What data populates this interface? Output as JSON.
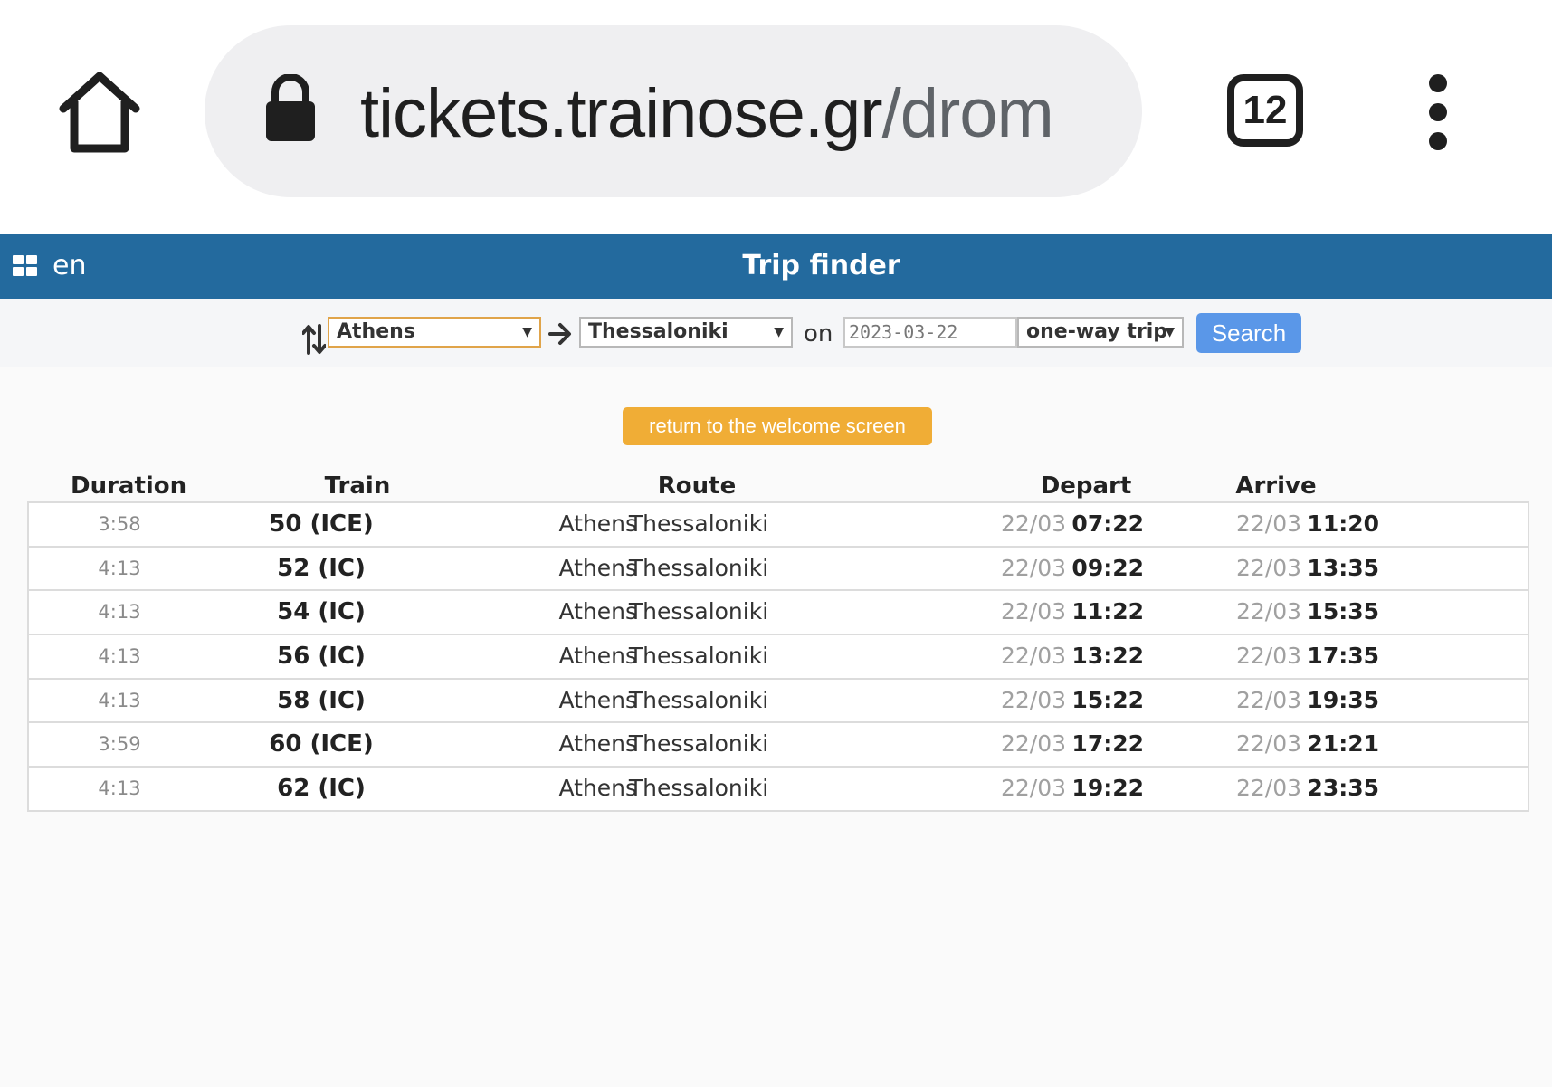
{
  "browser": {
    "url_host": "tickets.trainose.gr",
    "url_path": "/drom",
    "tab_count": "12",
    "icons": {
      "home": "home-icon",
      "lock": "lock-icon",
      "menu": "more-vert-icon"
    }
  },
  "header": {
    "language": "en",
    "title": "Trip finder",
    "background_color": "#236a9e",
    "icons": {
      "grid": "grid-icon"
    }
  },
  "search": {
    "from": "Athens",
    "to": "Thessaloniki",
    "on_label": "on",
    "date": "2023-03-22",
    "trip_type": "one-way trip",
    "search_label": "Search",
    "search_color": "#5a97e8",
    "icons": {
      "swap": "swap-icon",
      "arrow": "arrow-right-icon",
      "caret": "▼"
    }
  },
  "return_button": {
    "label": "return to the welcome screen",
    "color": "#f0ad36"
  },
  "results": {
    "columns": [
      "Duration",
      "Train",
      "Route",
      "Depart",
      "Arrive"
    ],
    "rows": [
      {
        "duration": "3:58",
        "train": "50 (ICE)",
        "from": "Athens",
        "to": "Thessaloniki",
        "depart_date": "22/03",
        "depart_time": "07:22",
        "arrive_date": "22/03",
        "arrive_time": "11:20"
      },
      {
        "duration": "4:13",
        "train": "52 (IC)",
        "from": "Athens",
        "to": "Thessaloniki",
        "depart_date": "22/03",
        "depart_time": "09:22",
        "arrive_date": "22/03",
        "arrive_time": "13:35"
      },
      {
        "duration": "4:13",
        "train": "54 (IC)",
        "from": "Athens",
        "to": "Thessaloniki",
        "depart_date": "22/03",
        "depart_time": "11:22",
        "arrive_date": "22/03",
        "arrive_time": "15:35"
      },
      {
        "duration": "4:13",
        "train": "56 (IC)",
        "from": "Athens",
        "to": "Thessaloniki",
        "depart_date": "22/03",
        "depart_time": "13:22",
        "arrive_date": "22/03",
        "arrive_time": "17:35"
      },
      {
        "duration": "4:13",
        "train": "58 (IC)",
        "from": "Athens",
        "to": "Thessaloniki",
        "depart_date": "22/03",
        "depart_time": "15:22",
        "arrive_date": "22/03",
        "arrive_time": "19:35"
      },
      {
        "duration": "3:59",
        "train": "60 (ICE)",
        "from": "Athens",
        "to": "Thessaloniki",
        "depart_date": "22/03",
        "depart_time": "17:22",
        "arrive_date": "22/03",
        "arrive_time": "21:21"
      },
      {
        "duration": "4:13",
        "train": "62 (IC)",
        "from": "Athens",
        "to": "Thessaloniki",
        "depart_date": "22/03",
        "depart_time": "19:22",
        "arrive_date": "22/03",
        "arrive_time": "23:35"
      }
    ]
  }
}
